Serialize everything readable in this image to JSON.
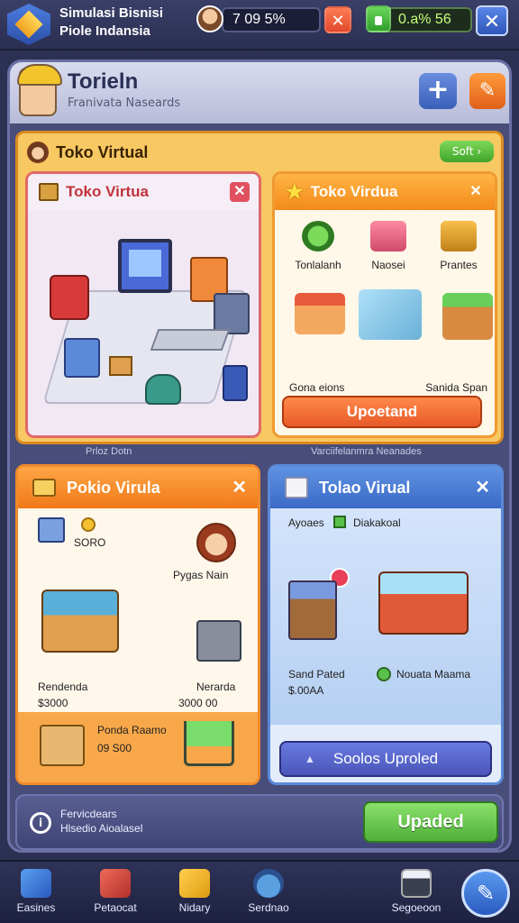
{
  "topbar": {
    "title_line1": "Simulasi Bisnisi",
    "title_line2": "Piole Indansia",
    "stat_a": "7   09     5%",
    "stat_b": "0.a%   56",
    "x_glyph": "✕",
    "close_glyph": "✕"
  },
  "panel": {
    "title": "Torieln",
    "subtitle": "Franivata Naseards",
    "plus_glyph": "+",
    "tool_glyph": "✎"
  },
  "big_card": {
    "title": "Toko Virtual",
    "soft_button": "Soft ›",
    "left": {
      "title": "Toko Virtua",
      "close_glyph": "✕"
    },
    "right": {
      "title": "Toko Virdua",
      "close_glyph": "✕",
      "items": [
        "Tonlalanh",
        "Naosei",
        "Prantes"
      ],
      "labels": [
        "Gona eions",
        "Sanida Span"
      ],
      "button": "Upoetand"
    },
    "caption_left": "Prloz Dotn",
    "caption_right": "Varciifelanmra Neanades"
  },
  "card_bottom_left": {
    "title": "Pokio Virula",
    "close_glyph": "✕",
    "coin_label": "SORO",
    "person_label": "Pygas Nain",
    "item1_name": "Rendenda",
    "item1_price": "$3000",
    "item2_name": "Nerarda",
    "item2_price": "3000 00",
    "footer_name": "Ponda Raamo",
    "footer_price": "09 S00"
  },
  "card_bottom_right": {
    "title": "Tolao Virual",
    "close_glyph": "✕",
    "tag_left": "Ayoaes",
    "tag_right": "Diakakoal",
    "label_left_1": "Sand Pated",
    "label_left_2": "$.00AA",
    "label_right": "Nouata Maama",
    "button": "Soolos Uproled",
    "button_triangle": "▲"
  },
  "info_bar": {
    "line1": "Fervicdears",
    "line2": "Hlsedio Aioalasel",
    "icon_glyph": "i",
    "button": "Upaded"
  },
  "bottom_nav": {
    "items": [
      "Easines",
      "Petaocat",
      "Nidary",
      "Serdnao",
      "Segoeoon"
    ],
    "fab_glyph": "✎"
  },
  "colors": {
    "background": "#2c3154",
    "accent_orange": "#f08a2a",
    "accent_blue": "#3a6ac6",
    "accent_green": "#4fb03a"
  }
}
